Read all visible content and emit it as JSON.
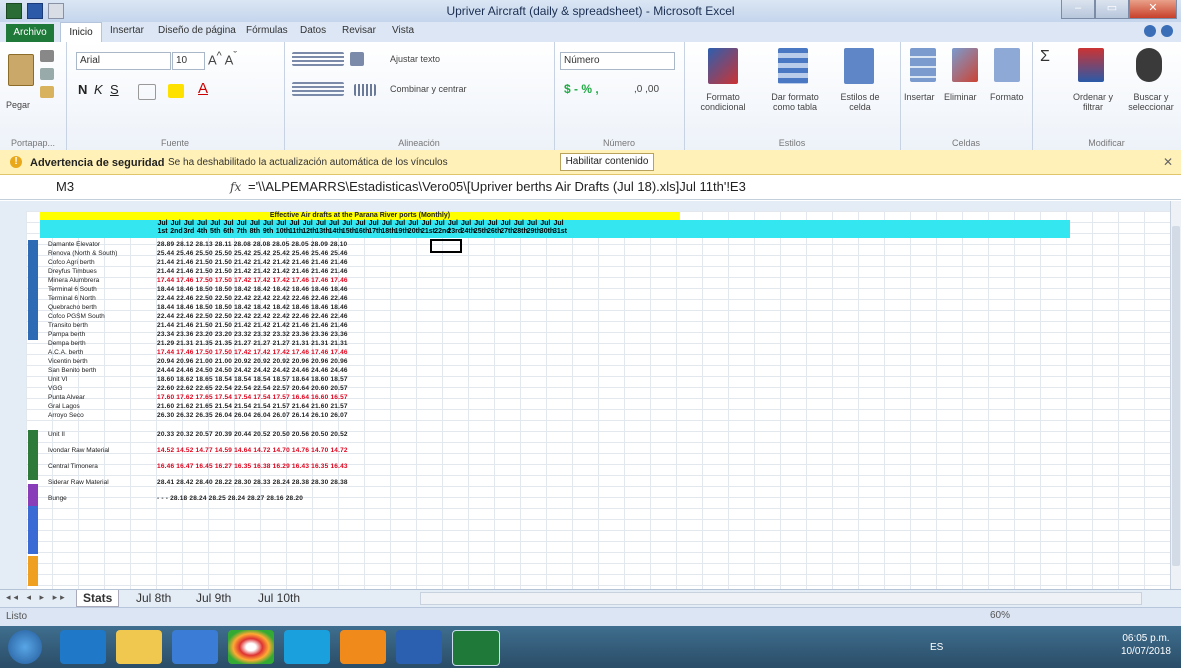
{
  "window": {
    "title": "Upriver Aircraft (daily & spreadsheet) - Microsoft Excel"
  },
  "ribbon_tabs": [
    "Archivo",
    "Inicio",
    "Insertar",
    "Diseño de página",
    "Fórmulas",
    "Datos",
    "Revisar",
    "Vista"
  ],
  "ribbon": {
    "paste": "Pegar",
    "font_name": "Arial",
    "font_size": "10",
    "wrap_text": "Ajustar texto",
    "merge_center": "Combinar y centrar",
    "number_format": "Número",
    "cond_format": "Formato condicional",
    "format_table": "Dar formato como tabla",
    "cell_styles": "Estilos de celda",
    "insert": "Insertar",
    "delete": "Eliminar",
    "format": "Formato",
    "sort_filter": "Ordenar y filtrar",
    "find_select": "Buscar y seleccionar",
    "groups": [
      "Portapap...",
      "Fuente",
      "Alineación",
      "Número",
      "Estilos",
      "Celdas",
      "Modificar"
    ]
  },
  "security_bar": {
    "title": "Advertencia de seguridad",
    "message": "Se ha deshabilitado la actualización automática de los vínculos",
    "button": "Habilitar contenido"
  },
  "formula_bar": {
    "name_box": "M3",
    "fx": "fx",
    "formula": "='\\\\ALPEMARRS\\Estadisticas\\Vero05\\[Upriver berths Air Drafts (Jul 18).xls]Jul 11th'!E3"
  },
  "sheet": {
    "banner": "Effective Air drafts at the Parana River ports (Monthly)",
    "headers": [
      "Jul 1st",
      "Jul 2nd",
      "Jul 3rd",
      "Jul 4th",
      "Jul 5th",
      "Jul 6th",
      "Jul 7th",
      "Jul 8th",
      "Jul 9th",
      "Jul 10th",
      "Jul 11th",
      "Jul 12th",
      "Jul 13th",
      "Jul 14th",
      "Jul 15th",
      "Jul 16th",
      "Jul 17th",
      "Jul 18th",
      "Jul 19th",
      "Jul 20th",
      "Jul 21st",
      "Jul 22nd",
      "Jul 23rd",
      "Jul 24th",
      "Jul 25th",
      "Jul 26th",
      "Jul 27th",
      "Jul 28th",
      "Jul 29th",
      "Jul 30th",
      "Jul 31st"
    ],
    "rows": [
      {
        "label": "Damante Elevator",
        "vals": "28.89 28.12 28.13 28.11 28.08 28.08 28.05 28.05 28.09 28.10",
        "red": false
      },
      {
        "label": "Renova (North & South)",
        "vals": "25.44 25.46 25.50 25.50 25.42 25.42 25.42 25.46 25.46 25.46",
        "red": false
      },
      {
        "label": "Cofco Agri berth",
        "vals": "21.44 21.46 21.50 21.50 21.42 21.42 21.42 21.46 21.46 21.46",
        "red": false
      },
      {
        "label": "Dreyfus Timbues",
        "vals": "21.44 21.46 21.50 21.50 21.42 21.42 21.42 21.46 21.46 21.46",
        "red": false
      },
      {
        "label": "Minera Alumbrera",
        "vals": "17.44 17.46 17.50 17.50 17.42 17.42 17.42 17.46 17.46 17.46",
        "red": true
      },
      {
        "label": "Terminal 6 South",
        "vals": "18.44 18.46 18.50 18.50 18.42 18.42 18.42 18.46 18.46 18.46",
        "red": false
      },
      {
        "label": "Terminal 6 North",
        "vals": "22.44 22.46 22.50 22.50 22.42 22.42 22.42 22.46 22.46 22.46",
        "red": false
      },
      {
        "label": "Quebracho berth",
        "vals": "18.44 18.46 18.50 18.50 18.42 18.42 18.42 18.46 18.46 18.46",
        "red": false
      },
      {
        "label": "Cofco PGSM South",
        "vals": "22.44 22.46 22.50 22.50 22.42 22.42 22.42 22.46 22.46 22.46",
        "red": false
      },
      {
        "label": "Transito berth",
        "vals": "21.44 21.46 21.50 21.50 21.42 21.42 21.42 21.46 21.46 21.46",
        "red": false
      },
      {
        "label": "Pampa berth",
        "vals": "23.34 23.36 23.20 23.20 23.32 23.32 23.32 23.36 23.36 23.36",
        "red": false
      },
      {
        "label": "Dempa berth",
        "vals": "21.29 21.31 21.35 21.35 21.27 21.27 21.27 21.31 21.31 21.31",
        "red": false
      },
      {
        "label": "A.C.A. berth",
        "vals": "17.44 17.46 17.50 17.50 17.42 17.42 17.42 17.46 17.46 17.46",
        "red": true
      },
      {
        "label": "Vicentin berth",
        "vals": "20.94 20.96 21.00 21.00 20.92 20.92 20.92 20.96 20.96 20.96",
        "red": false
      },
      {
        "label": "San Benito berth",
        "vals": "24.44 24.46 24.50 24.50 24.42 24.42 24.42 24.46 24.46 24.46",
        "red": false
      },
      {
        "label": "Unit VI",
        "vals": "18.60 18.62 18.65 18.54 18.54 18.54 18.57 18.64 18.60 18.57",
        "red": false
      },
      {
        "label": "VGG",
        "vals": "22.60 22.62 22.65 22.54 22.54 22.54 22.57 20.64 20.60 20.57",
        "red": false
      },
      {
        "label": "Punta Alvear",
        "vals": "17.60 17.62 17.65 17.54 17.54 17.54 17.57 16.64 16.60 16.57",
        "red": true
      },
      {
        "label": "Gral Lagos",
        "vals": "21.60 21.62 21.65 21.54 21.54 21.54 21.57 21.64 21.60 21.57",
        "red": false
      },
      {
        "label": "Arroyo Seco",
        "vals": "26.30 26.32 26.35 26.04 26.04 26.04 26.07 26.14 26.10 26.07",
        "red": false
      },
      {
        "label": "Unit II",
        "vals": "20.33 20.32 20.57 20.39 20.44 20.52 20.50 20.56 20.50 20.52",
        "red": false
      },
      {
        "label": "Ivondar Raw Material",
        "vals": "14.52 14.52 14.77 14.59 14.64 14.72 14.70 14.76 14.70 14.72",
        "red": true
      },
      {
        "label": "Central Timonera",
        "vals": "16.46 16.47 16.45 16.27 16.35 16.38 16.29 16.43 16.35 16.43",
        "red": true
      },
      {
        "label": "Siderar Raw Material",
        "vals": "28.41 28.42 28.40 28.22 28.30 28.33 28.24 28.38 28.30 28.38",
        "red": false
      },
      {
        "label": "Bunge",
        "vals": "  -      -      -   28.18 28.24 28.25 28.24 28.27 28.16 28.20",
        "red": false
      }
    ],
    "tabs": [
      "Stats",
      "Jul 8th",
      "Jul 9th",
      "Jul 10th"
    ]
  },
  "status": {
    "text": "Listo",
    "zoom": "60%"
  },
  "taskbar": {
    "lang": "ES",
    "time": "06:05 p.m.",
    "date": "10/07/2018"
  }
}
